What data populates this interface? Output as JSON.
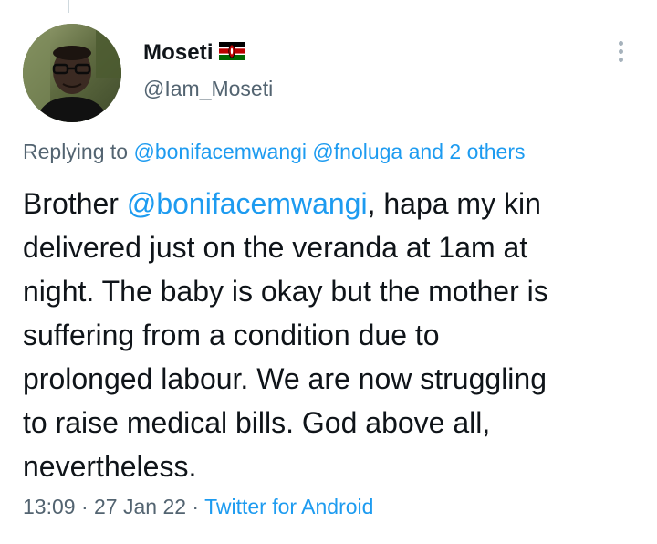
{
  "author": {
    "display_name": "Moseti",
    "flag_emoji": "🇰🇪",
    "handle": "@Iam_Moseti"
  },
  "reply_context": {
    "prefix": "Replying to ",
    "mention_1": "@bonifacemwangi",
    "mention_2": "@fnoluga",
    "others": "and 2 others"
  },
  "tweet": {
    "lines": [
      {
        "pre": "Brother ",
        "mention": "@bonifacemwangi",
        "post": ", hapa my kin"
      },
      {
        "text": "delivered just on the veranda at 1am at"
      },
      {
        "text": "night. The baby is okay but the mother is"
      },
      {
        "text": "suffering from a condition due to"
      },
      {
        "text": "prolonged labour. We are now struggling"
      },
      {
        "text": "to raise medical bills. God above all,"
      },
      {
        "text": "nevertheless."
      }
    ]
  },
  "meta": {
    "time": "13:09",
    "sep1": " · ",
    "date": "27 Jan 22",
    "sep2": " · ",
    "source": "Twitter for Android"
  },
  "colors": {
    "link": "#1d9bf0",
    "secondary_text": "#536471",
    "primary_text": "#0f1419"
  }
}
